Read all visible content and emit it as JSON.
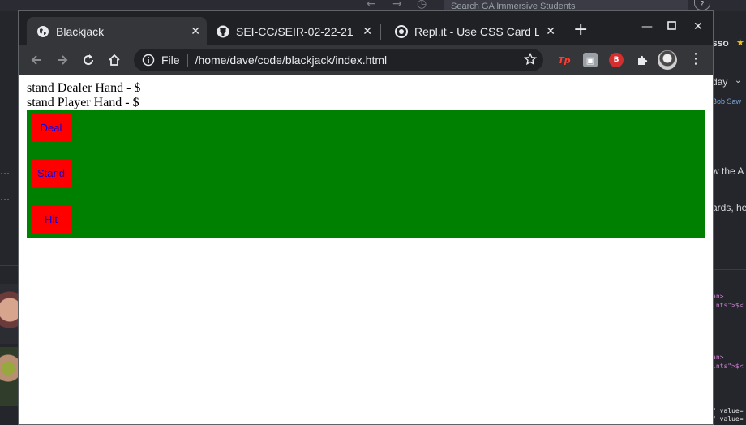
{
  "background": {
    "search_placeholder": "Search GA Immersive Students",
    "help_icon": "?",
    "left_snippets": [
      "…",
      "…"
    ],
    "right_snippets": [
      "sso",
      "day",
      "Bob Saw",
      "w the A",
      "ards, he"
    ],
    "right_code": [
      "an>",
      "ints\">$<",
      "an>",
      "ints\">$<",
      "\" value=",
      "\" value="
    ]
  },
  "tabs": [
    {
      "title": "Blackjack",
      "favicon": "globe-icon"
    },
    {
      "title": "SEI-CC/SEIR-02-22-21",
      "favicon": "github-icon"
    },
    {
      "title": "Repl.it - Use CSS Card Li",
      "favicon": "replit-icon"
    }
  ],
  "omnibox": {
    "scheme": "File",
    "url": "/home/dave/code/blackjack/index.html"
  },
  "extensions": [
    "Tp",
    "▣",
    "B"
  ],
  "page": {
    "dealer_line": "stand Dealer Hand - $",
    "player_line": "stand Player Hand - $",
    "buttons": {
      "deal": "Deal",
      "stand": "Stand",
      "hit": "Hit"
    },
    "table_color": "#008000",
    "button_color": "#ff0000",
    "button_text_color": "#0000ee"
  },
  "colors": {
    "tab_active": "#35363a",
    "window_frame": "#202124"
  }
}
